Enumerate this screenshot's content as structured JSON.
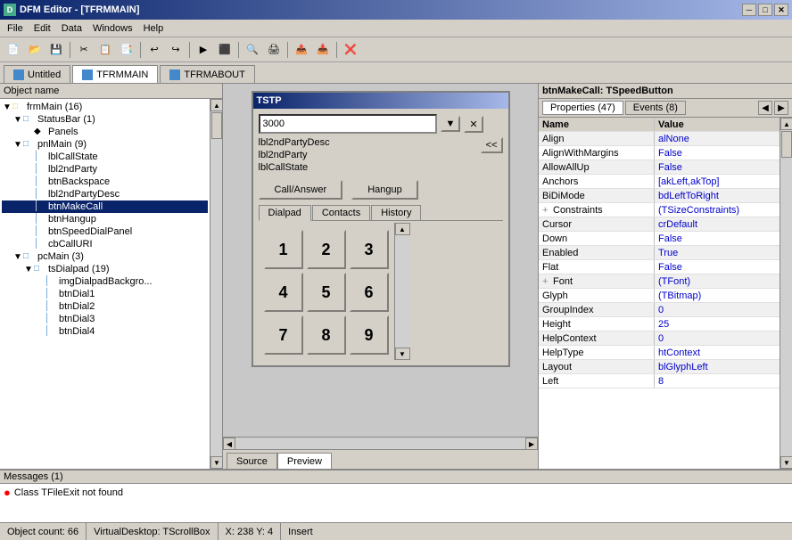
{
  "titleBar": {
    "title": "DFM Editor - [TFRMMAIN]",
    "iconLabel": "D",
    "btnMin": "─",
    "btnMax": "□",
    "btnClose": "✕"
  },
  "menuBar": {
    "items": [
      "File",
      "Edit",
      "Data",
      "Windows",
      "Help"
    ]
  },
  "toolbar": {
    "buttons": [
      "📄",
      "📂",
      "💾",
      "✂️",
      "📋",
      "📑",
      "↩",
      "↪",
      "▶",
      "⏹",
      "🔍",
      "🖨",
      "📤",
      "📥",
      "❌"
    ]
  },
  "tabs": [
    {
      "label": "Untitled",
      "active": false
    },
    {
      "label": "TFRMMAIN",
      "active": true
    },
    {
      "label": "TFRMABOUT",
      "active": false
    }
  ],
  "objectTree": {
    "header": "Object name",
    "items": [
      {
        "indent": 0,
        "expand": "▼",
        "icon": "□",
        "label": "frmMain (16)",
        "selected": false
      },
      {
        "indent": 1,
        "expand": "▼",
        "icon": "□",
        "label": "StatusBar (1)",
        "selected": false
      },
      {
        "indent": 2,
        "expand": "",
        "icon": "◆",
        "label": "Panels",
        "selected": false
      },
      {
        "indent": 1,
        "expand": "▼",
        "icon": "□",
        "label": "pnlMain (9)",
        "selected": false
      },
      {
        "indent": 2,
        "expand": "",
        "icon": "│",
        "label": "lblCallState",
        "selected": false
      },
      {
        "indent": 2,
        "expand": "",
        "icon": "│",
        "label": "lbl2ndParty",
        "selected": false
      },
      {
        "indent": 2,
        "expand": "",
        "icon": "│",
        "label": "btnBackspace",
        "selected": false
      },
      {
        "indent": 2,
        "expand": "",
        "icon": "│",
        "label": "lbl2ndPartyDesc",
        "selected": false
      },
      {
        "indent": 2,
        "expand": "",
        "icon": "│",
        "label": "btnMakeCall",
        "selected": true
      },
      {
        "indent": 2,
        "expand": "",
        "icon": "│",
        "label": "btnHangup",
        "selected": false
      },
      {
        "indent": 2,
        "expand": "",
        "icon": "│",
        "label": "btnSpeedDialPanel",
        "selected": false
      },
      {
        "indent": 2,
        "expand": "",
        "icon": "│",
        "label": "cbCallURI",
        "selected": false
      },
      {
        "indent": 1,
        "expand": "▼",
        "icon": "□",
        "label": "pcMain (3)",
        "selected": false
      },
      {
        "indent": 2,
        "expand": "▼",
        "icon": "□",
        "label": "tsDialpad (19)",
        "selected": false
      },
      {
        "indent": 3,
        "expand": "",
        "icon": "│",
        "label": "imgDialpadBackgro...",
        "selected": false
      },
      {
        "indent": 3,
        "expand": "",
        "icon": "│",
        "label": "btnDial1",
        "selected": false
      },
      {
        "indent": 3,
        "expand": "",
        "icon": "│",
        "label": "btnDial2",
        "selected": false
      },
      {
        "indent": 3,
        "expand": "",
        "icon": "│",
        "label": "btnDial3",
        "selected": false
      },
      {
        "indent": 3,
        "expand": "",
        "icon": "│",
        "label": "btnDial4",
        "selected": false
      }
    ]
  },
  "formDesigner": {
    "title": "TSTP",
    "inputValue": "3000",
    "lbl1": "lbl2ndPartyDesc",
    "lbl2": "lbl2ndParty",
    "lbl3": "lblCallState",
    "btnCallAnswer": "Call/Answer",
    "btnHangup": "Hangup",
    "dialpadTabs": [
      "Dialpad",
      "Contacts",
      "History"
    ],
    "dialpadActiveTab": "Dialpad",
    "dialpadButtons": [
      "1",
      "2",
      "3",
      "4",
      "5",
      "6",
      "7",
      "8",
      "9"
    ],
    "sourceTabs": [
      "Source",
      "Preview"
    ],
    "activeSourceTab": "Preview"
  },
  "rightPanel": {
    "objectTitle": "btnMakeCall: TSpeedButton",
    "propTabLabel": "Properties (47)",
    "eventsTabLabel": "Events (8)",
    "properties": [
      {
        "name": "Name",
        "value": "Value",
        "isHeader": true
      },
      {
        "name": "Align",
        "value": "alNone"
      },
      {
        "name": "AlignWithMargins",
        "value": "False"
      },
      {
        "name": "AllowAllUp",
        "value": "False"
      },
      {
        "name": "Anchors",
        "value": "[akLeft,akTop]"
      },
      {
        "name": "BiDiMode",
        "value": "bdLeftToRight"
      },
      {
        "expand": "+",
        "name": "Constraints",
        "value": "(TSizeConstraints)"
      },
      {
        "name": "Cursor",
        "value": "crDefault"
      },
      {
        "name": "Down",
        "value": "False"
      },
      {
        "name": "Enabled",
        "value": "True"
      },
      {
        "name": "Flat",
        "value": "False"
      },
      {
        "expand": "+",
        "name": "Font",
        "value": "(TFont)"
      },
      {
        "name": "Glyph",
        "value": "(TBitmap)"
      },
      {
        "name": "GroupIndex",
        "value": "0"
      },
      {
        "name": "Height",
        "value": "25"
      },
      {
        "name": "HelpContext",
        "value": "0"
      },
      {
        "name": "HelpType",
        "value": "htContext"
      },
      {
        "name": "Layout",
        "value": "blGlyphLeft"
      },
      {
        "name": "Left",
        "value": "8"
      }
    ]
  },
  "messagesSection": {
    "header": "Messages (1)",
    "messages": [
      {
        "type": "error",
        "text": "Class TFileExit not found"
      }
    ]
  },
  "statusBar": {
    "objectCount": "Object count: 66",
    "virtualDesktop": "VirtualDesktop: TScrollBox",
    "coords": "X: 238  Y: 4",
    "mode": "Insert"
  }
}
